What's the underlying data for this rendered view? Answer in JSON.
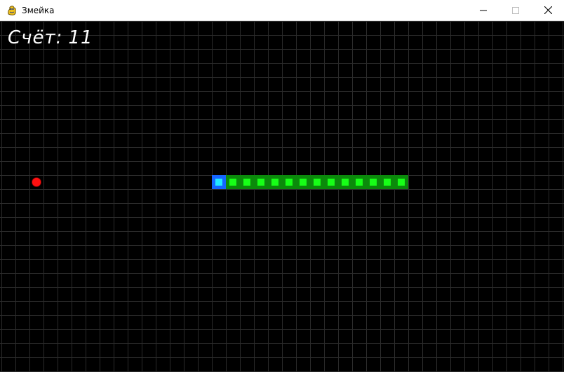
{
  "window": {
    "title": "Змейка",
    "icon": "pygame-snake-icon",
    "controls": [
      "minimize-icon",
      "maximize-icon",
      "close-icon"
    ]
  },
  "hud": {
    "score_label": "Счёт:",
    "score_value": "11"
  },
  "game": {
    "grid_cell_size": 20,
    "grid_color": "#2b2b2b",
    "background_color": "#000000",
    "snake": {
      "direction": "left",
      "head_color": "#1565ff",
      "head_inner_color": "#22e8ff",
      "body_color": "#0b8a0b",
      "body_inner_color": "#17ff17",
      "segments": [
        {
          "col": 15,
          "row": 11,
          "part": "head"
        },
        {
          "col": 16,
          "row": 11,
          "part": "body"
        },
        {
          "col": 17,
          "row": 11,
          "part": "body"
        },
        {
          "col": 18,
          "row": 11,
          "part": "body"
        },
        {
          "col": 19,
          "row": 11,
          "part": "body"
        },
        {
          "col": 20,
          "row": 11,
          "part": "body"
        },
        {
          "col": 21,
          "row": 11,
          "part": "body"
        },
        {
          "col": 22,
          "row": 11,
          "part": "body"
        },
        {
          "col": 23,
          "row": 11,
          "part": "body"
        },
        {
          "col": 24,
          "row": 11,
          "part": "body"
        },
        {
          "col": 25,
          "row": 11,
          "part": "body"
        },
        {
          "col": 26,
          "row": 11,
          "part": "body"
        },
        {
          "col": 27,
          "row": 11,
          "part": "body"
        },
        {
          "col": 28,
          "row": 11,
          "part": "body"
        }
      ]
    },
    "food": {
      "col": 2,
      "row": 11,
      "color": "#ff1010"
    }
  }
}
